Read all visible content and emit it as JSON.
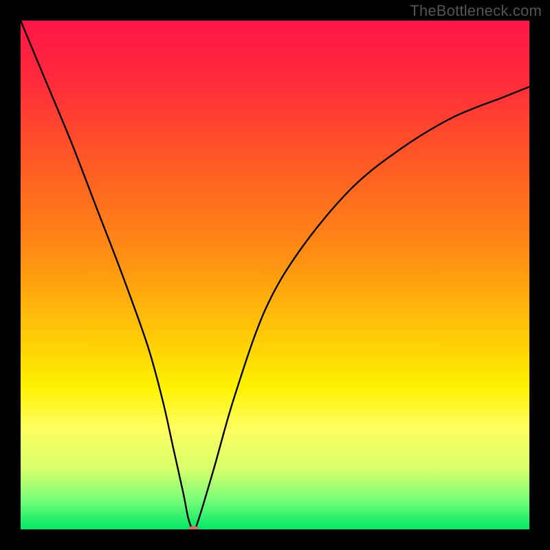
{
  "watermark": "TheBottleneck.com",
  "chart_data": {
    "type": "line",
    "title": "",
    "xlabel": "",
    "ylabel": "",
    "xlim": [
      0,
      100
    ],
    "ylim": [
      0,
      100
    ],
    "background": {
      "type": "vertical-gradient",
      "stops": [
        {
          "pct": 0,
          "color": "#ff1648"
        },
        {
          "pct": 12,
          "color": "#ff2b3a"
        },
        {
          "pct": 28,
          "color": "#ff5a24"
        },
        {
          "pct": 45,
          "color": "#ff8a14"
        },
        {
          "pct": 60,
          "color": "#ffc208"
        },
        {
          "pct": 72,
          "color": "#fff200"
        },
        {
          "pct": 80,
          "color": "#fffe5e"
        },
        {
          "pct": 88,
          "color": "#d9ff6a"
        },
        {
          "pct": 94,
          "color": "#7cff7a"
        },
        {
          "pct": 100,
          "color": "#00e763"
        }
      ]
    },
    "series": [
      {
        "name": "bottleneck-curve",
        "color": "#000000",
        "x": [
          0,
          5,
          10,
          15,
          20,
          25,
          28,
          30,
          32,
          33,
          34,
          35,
          38,
          42,
          48,
          55,
          65,
          75,
          85,
          95,
          100
        ],
        "y": [
          100,
          88,
          76,
          63,
          50,
          36,
          25,
          16,
          7,
          2,
          0,
          2,
          12,
          26,
          43,
          55,
          67,
          75,
          81,
          85,
          87
        ]
      }
    ],
    "markers": [
      {
        "name": "optimal-point",
        "x": 34,
        "y": 0,
        "color": "#cc6f6a",
        "rx": 8,
        "ry": 5
      }
    ]
  }
}
